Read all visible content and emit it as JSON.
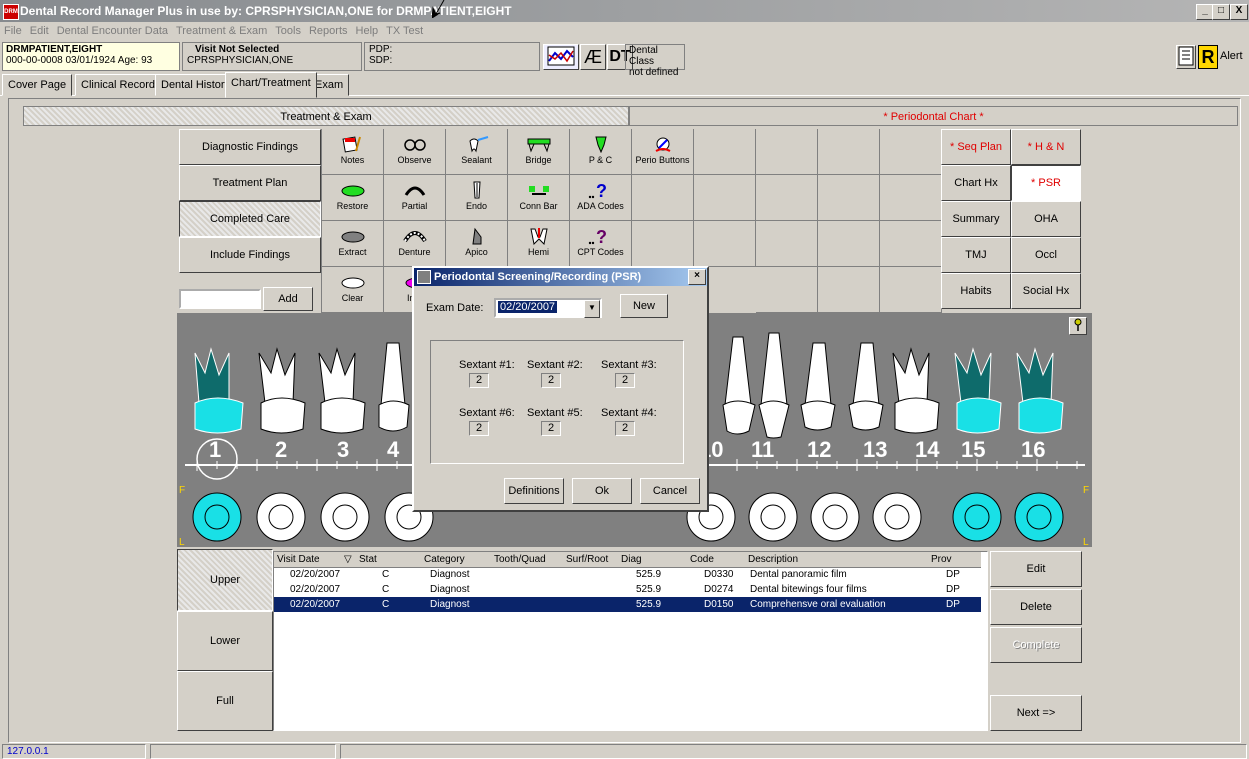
{
  "window": {
    "title": "Dental Record Manager Plus in use by: CPRSPHYSICIAN,ONE for DRMPATIENT,EIGHT",
    "controls": [
      "_",
      "□",
      "X"
    ]
  },
  "menu": [
    "File",
    "Edit",
    "Dental Encounter Data",
    "Treatment & Exam",
    "Tools",
    "Reports",
    "Help",
    "TX Test"
  ],
  "patient": {
    "name": "DRMPATIENT,EIGHT",
    "id_line": "000-00-0008   03/01/1924 Age: 93",
    "visit_title": "Visit Not Selected",
    "provider": "CPRSPHYSICIAN,ONE",
    "pdp": "PDP:",
    "sdp": "SDP:",
    "icon_ae": "Æ",
    "icon_dt": "DT",
    "dental_class": "Dental Class",
    "dental_class_value": "not defined",
    "alert": "Alert",
    "r_label": "R"
  },
  "tabs": [
    "Cover Page",
    "Clinical Record",
    "Dental History",
    "Chart/Treatment",
    "Exam"
  ],
  "section_headers": {
    "left": "Treatment & Exam",
    "right": "* Periodontal Chart *"
  },
  "left_buttons": [
    "Diagnostic Findings",
    "Treatment Plan",
    "Completed Care",
    "Include Findings"
  ],
  "add_button": "Add",
  "tools": [
    [
      "Notes",
      "Observe",
      "Sealant",
      "Bridge",
      "P & C",
      "Perio Buttons"
    ],
    [
      "Restore",
      "Partial",
      "Endo",
      "Conn Bar",
      "ADA Codes"
    ],
    [
      "Extract",
      "Denture",
      "Apico",
      "Hemi",
      "CPT Codes"
    ],
    [
      "Clear",
      "Imp"
    ]
  ],
  "right_buttons": [
    [
      "* Seq Plan",
      "* H & N"
    ],
    [
      "Chart Hx",
      "* PSR"
    ],
    [
      "Summary",
      "OHA"
    ],
    [
      "TMJ",
      "Occl"
    ],
    [
      "Habits",
      "Social Hx"
    ]
  ],
  "teeth_numbers": [
    "1",
    "2",
    "3",
    "4",
    "10",
    "11",
    "12",
    "13",
    "14",
    "15",
    "16"
  ],
  "chart_side_labels": {
    "f": "F",
    "l": "L"
  },
  "dialog": {
    "title": "Periodontal Screening/Recording (PSR)",
    "exam_date_label": "Exam Date:",
    "exam_date": "02/20/2007",
    "new_button": "New",
    "sextants": [
      {
        "label": "Sextant #1:",
        "value": "2"
      },
      {
        "label": "Sextant #2:",
        "value": "2"
      },
      {
        "label": "Sextant #3:",
        "value": "2"
      },
      {
        "label": "Sextant #6:",
        "value": "2"
      },
      {
        "label": "Sextant #5:",
        "value": "2"
      },
      {
        "label": "Sextant #4:",
        "value": "2"
      }
    ],
    "definitions_button": "Definitions",
    "ok_button": "Ok",
    "cancel_button": "Cancel"
  },
  "arch_buttons": [
    "Upper",
    "Lower",
    "Full"
  ],
  "table": {
    "columns": [
      "Visit Date",
      "Stat",
      "Category",
      "Tooth/Quad",
      "Surf/Root",
      "Diag",
      "Code",
      "Description",
      "Prov"
    ],
    "rows": [
      [
        "02/20/2007",
        "C",
        "Diagnost",
        "",
        "",
        "525.9",
        "D0330",
        "Dental panoramic film",
        "DP"
      ],
      [
        "02/20/2007",
        "C",
        "Diagnost",
        "",
        "",
        "525.9",
        "D0274",
        "Dental bitewings four films",
        "DP"
      ],
      [
        "02/20/2007",
        "C",
        "Diagnost",
        "",
        "",
        "525.9",
        "D0150",
        "Comprehensve oral evaluation",
        "DP"
      ]
    ],
    "selected_row": 2
  },
  "action_buttons": [
    "Edit",
    "Delete",
    "Complete",
    "Next =>"
  ],
  "status": {
    "ip": "127.0.0.1"
  },
  "colors": {
    "title_gray": "#868a8e",
    "selected": "#0a246a",
    "tooth_teal": "#0e6b6b",
    "crown_cyan": "#19e0e6",
    "red_text": "#e00000",
    "green": "#22dd22"
  }
}
